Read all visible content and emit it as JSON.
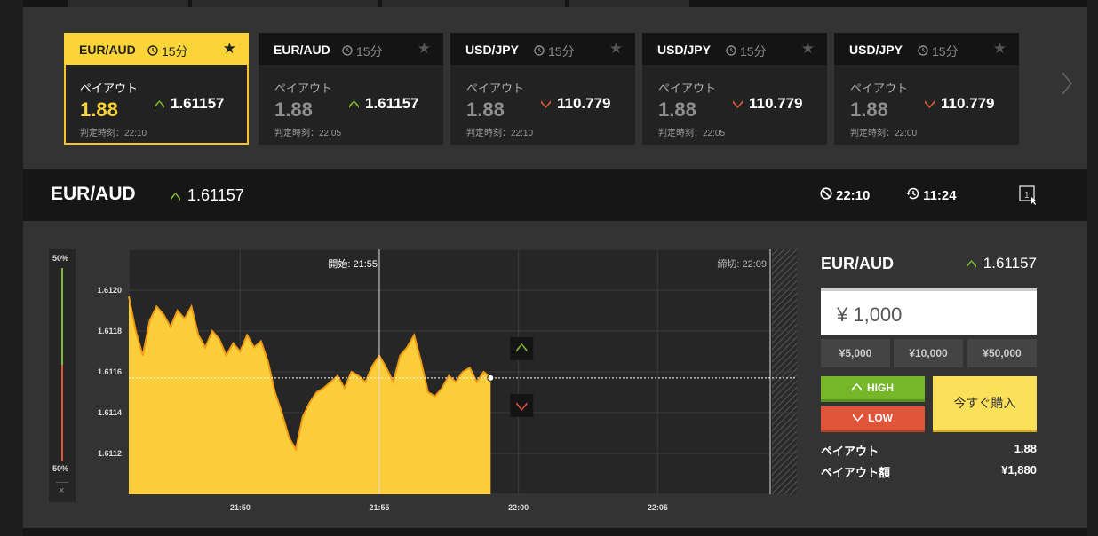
{
  "asset_cards": [
    {
      "pair": "EUR/AUD",
      "duration": "15分",
      "payout_label": "ペイアウト",
      "payout": "1.88",
      "direction": "up",
      "price": "1.61157",
      "expiry": "判定時刻：22:10",
      "active": true
    },
    {
      "pair": "EUR/AUD",
      "duration": "15分",
      "payout_label": "ペイアウト",
      "payout": "1.88",
      "direction": "up",
      "price": "1.61157",
      "expiry": "判定時刻：22:05",
      "active": false
    },
    {
      "pair": "USD/JPY",
      "duration": "15分",
      "payout_label": "ペイアウト",
      "payout": "1.88",
      "direction": "down",
      "price": "110.779",
      "expiry": "判定時刻：22:10",
      "active": false
    },
    {
      "pair": "USD/JPY",
      "duration": "15分",
      "payout_label": "ペイアウト",
      "payout": "1.88",
      "direction": "down",
      "price": "110.779",
      "expiry": "判定時刻：22:05",
      "active": false
    },
    {
      "pair": "USD/JPY",
      "duration": "15分",
      "payout_label": "ペイアウト",
      "payout": "1.88",
      "direction": "down",
      "price": "110.779",
      "expiry": "判定時刻：22:00",
      "active": false
    }
  ],
  "header": {
    "pair": "EUR/AUD",
    "price": "1.61157",
    "close_time": "22:10",
    "remaining": "11:24"
  },
  "sentiment": {
    "high_pct": "50%",
    "low_pct": "50%",
    "high_fraction": 0.5,
    "close_glyph": "×"
  },
  "chart": {
    "start_label": "開始: 21:55",
    "end_label": "締切: 22:09",
    "y_ticks": [
      "1.6120",
      "1.6118",
      "1.6116",
      "1.6114",
      "1.6112"
    ],
    "x_ticks": [
      "21:50",
      "21:55",
      "22:00",
      "22:05"
    ]
  },
  "chart_data": {
    "type": "area",
    "x_axis": "time",
    "x_ticks": [
      "21:50",
      "21:55",
      "22:00",
      "22:05"
    ],
    "y_ticks": [
      1.612,
      1.6118,
      1.6116,
      1.6114,
      1.6112
    ],
    "ylim": [
      1.611,
      1.6122
    ],
    "x_range_minutes": [
      "21:46",
      "22:10"
    ],
    "series": [
      {
        "color": "#f9c52f",
        "t": [
          "21:46:00",
          "21:46:15",
          "21:46:30",
          "21:46:45",
          "21:47:00",
          "21:47:15",
          "21:47:30",
          "21:47:45",
          "21:48:00",
          "21:48:15",
          "21:48:30",
          "21:48:45",
          "21:49:00",
          "21:49:15",
          "21:49:30",
          "21:49:45",
          "21:50:00",
          "21:50:15",
          "21:50:30",
          "21:50:45",
          "21:51:00",
          "21:51:15",
          "21:51:30",
          "21:51:45",
          "21:52:00",
          "21:52:15",
          "21:52:30",
          "21:52:45",
          "21:53:00",
          "21:53:15",
          "21:53:30",
          "21:53:45",
          "21:54:00",
          "21:54:15",
          "21:54:30",
          "21:54:45",
          "21:55:00",
          "21:55:15",
          "21:55:30",
          "21:55:45",
          "21:56:00",
          "21:56:15",
          "21:56:30",
          "21:56:45",
          "21:57:00",
          "21:57:15",
          "21:57:30",
          "21:57:45",
          "21:58:00",
          "21:58:15",
          "21:58:30",
          "21:58:45",
          "21:59:00"
        ],
        "y": [
          1.61197,
          1.6118,
          1.61168,
          1.61185,
          1.61192,
          1.61188,
          1.61182,
          1.6119,
          1.61186,
          1.61192,
          1.61178,
          1.61172,
          1.6118,
          1.61176,
          1.61168,
          1.61174,
          1.6117,
          1.61178,
          1.61172,
          1.61175,
          1.61165,
          1.6115,
          1.6114,
          1.61128,
          1.61122,
          1.61138,
          1.61145,
          1.6115,
          1.61152,
          1.61155,
          1.61158,
          1.61152,
          1.6116,
          1.61158,
          1.61155,
          1.61163,
          1.61168,
          1.61162,
          1.61155,
          1.61168,
          1.61172,
          1.61178,
          1.61165,
          1.6115,
          1.61148,
          1.61152,
          1.61158,
          1.61155,
          1.6116,
          1.61162,
          1.61155,
          1.6116,
          1.61157
        ]
      }
    ],
    "current_level": 1.61157
  },
  "trade_panel": {
    "pair": "EUR/AUD",
    "price": "1.61157",
    "amount": "¥ 1,000",
    "quick_amounts": [
      "¥5,000",
      "¥10,000",
      "¥50,000"
    ],
    "high_label": "HIGH",
    "low_label": "LOW",
    "buy_label": "今すぐ購入",
    "payout_label": "ペイアウト",
    "payout_value": "1.88",
    "payout_amount_label": "ペイアウト額",
    "payout_amount_value": "¥1,880"
  },
  "colors": {
    "accent": "#fbd537",
    "up": "#7cba2f",
    "down": "#e0553a"
  }
}
